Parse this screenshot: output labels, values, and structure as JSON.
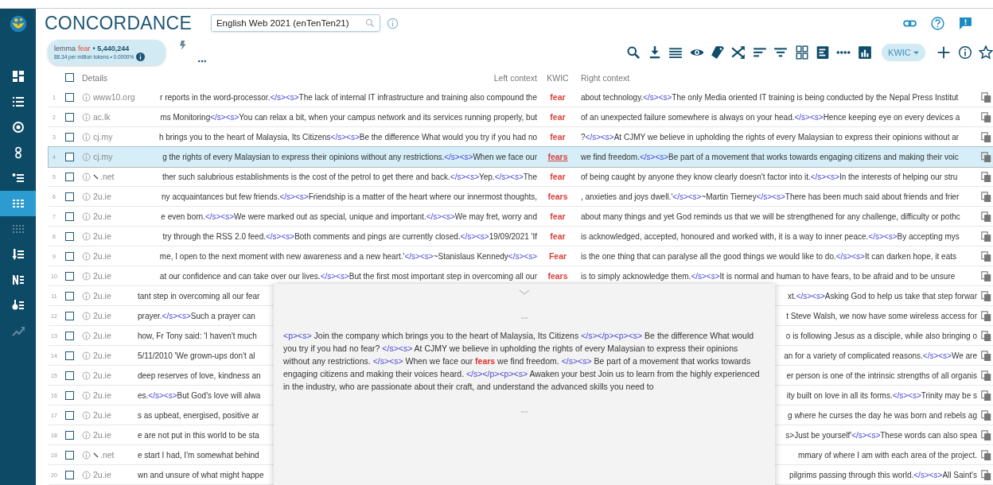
{
  "app": {
    "title": "CONCORDANCE"
  },
  "corpus_field": {
    "value": "English Web 2021 (enTenTen21)"
  },
  "sidebar": {
    "items": [
      {
        "selected": false,
        "disabled": false
      },
      {
        "selected": false,
        "disabled": false
      },
      {
        "selected": false,
        "disabled": false
      },
      {
        "selected": false,
        "disabled": false
      },
      {
        "selected": false,
        "disabled": false
      },
      {
        "selected": true,
        "disabled": false
      },
      {
        "selected": false,
        "disabled": true
      },
      {
        "selected": false,
        "disabled": false
      },
      {
        "selected": false,
        "disabled": false
      },
      {
        "selected": false,
        "disabled": false
      },
      {
        "selected": false,
        "disabled": true
      }
    ]
  },
  "query_summary": {
    "label": "lemma",
    "term": "fear",
    "hits": "• 5,440,244",
    "per_million": "88.34 per million tokens • 0.0000%"
  },
  "view_mode": {
    "label": "KWIC"
  },
  "table": {
    "select_all_checked": false,
    "columns": [
      "Details",
      "Left context",
      "KWIC",
      "Right context"
    ],
    "rows": [
      {
        "number": "1",
        "checked": false,
        "selected": false,
        "domain": "www10.org",
        "domain_icon": false,
        "left": "r reports in the word-processor.</s><s>The lack of internal IT infrastructure and training also compound the",
        "kwic": "fear",
        "right": "about technology.</s><s>The only Media oriented IT training is being conducted by the Nepal Press Institut"
      },
      {
        "number": "2",
        "checked": false,
        "selected": false,
        "domain": "ac.lk",
        "domain_icon": false,
        "left": "ms Monitoring</s><s>You can relax a bit, when your campus network and its services running properly, but",
        "kwic": "fear",
        "right": "of an unexpected failure somewhere is always on your head.</s><s>Hence keeping eye on every devices a"
      },
      {
        "number": "3",
        "checked": false,
        "selected": false,
        "domain": "cj.my",
        "domain_icon": false,
        "left": "h brings you to the heart of Malaysia, Its Citizens</s><s>Be the difference What would you try if you had no",
        "kwic": "fear",
        "right": "?</s><s>At CJMY we believe in upholding the rights of every Malaysian to express their opinions without ar"
      },
      {
        "number": "4",
        "checked": false,
        "selected": true,
        "domain": "cj.my",
        "domain_icon": false,
        "left": "g the rights of every Malaysian to express their opinions without any restrictions.</s><s>When we face our",
        "kwic": "fears",
        "right": "we find freedom.</s><s>Be part of a movement that works towards engaging citizens and making their voic"
      },
      {
        "number": "5",
        "checked": false,
        "selected": false,
        "domain": ".net",
        "domain_icon": true,
        "left": "ther such salubrious establishments is the cost of the petrol to get there and back.</s><s>Yep.</s><s>The",
        "kwic": "fear",
        "right": "of being caught by anyone they know clearly doesn't factor into it.</s><s>In the interests of helping our stru"
      },
      {
        "number": "6",
        "checked": false,
        "selected": false,
        "domain": "2u.ie",
        "domain_icon": false,
        "left": "ny acquaintances but few friends.</s><s>Friendship is a matter of the heart where our innermost thoughts,",
        "kwic": "fears",
        "right": ", anxieties and joys dwell.'</s><s>~Martin Tierney</s><s>There has been much said about friends and frier"
      },
      {
        "number": "7",
        "checked": false,
        "selected": false,
        "domain": "2u.ie",
        "domain_icon": false,
        "left": "e even born.</s><s>We were marked out as special, unique and important.</s><s>We may fret, worry and",
        "kwic": "fear",
        "right": "about many things and yet God reminds us that we will be strengthened for any challenge, difficulty or pothc"
      },
      {
        "number": "8",
        "checked": false,
        "selected": false,
        "domain": "2u.ie",
        "domain_icon": false,
        "left": "try through the RSS 2.0 feed.</s><s>Both comments and pings are currently closed.</s><s>19/09/2021 'If",
        "kwic": "fear",
        "right": "is acknowledged, accepted, honoured and worked with, it is a way to inner peace.</s><s>By accepting mys"
      },
      {
        "number": "9",
        "checked": false,
        "selected": false,
        "domain": "2u.ie",
        "domain_icon": false,
        "left": "me, I open to the next moment with new awareness and a new heart.'</s><s>~Stanislaus Kennedy</s><s>",
        "kwic": "Fear",
        "right": "is the one thing that can paralyse all the good things we would like to do.</s><s>It can darken hope, it eats"
      },
      {
        "number": "10",
        "checked": false,
        "selected": false,
        "domain": "2u.ie",
        "domain_icon": false,
        "left": "at our confidence and can take over our lives.</s><s>But the first most important step in overcoming all our",
        "kwic": "fears",
        "right": "is to simply acknowledge them.</s><s>It is normal and human to have fears, to be afraid and to be unsure"
      },
      {
        "number": "11",
        "checked": false,
        "selected": false,
        "domain": "2u.ie",
        "domain_icon": false,
        "left": "tant step in overcoming all our fear",
        "right": "xt.</s><s>Asking God to help us take that step forwar"
      },
      {
        "number": "12",
        "checked": false,
        "selected": false,
        "domain": "2u.ie",
        "domain_icon": false,
        "left": "prayer.</s><s>Such a prayer can",
        "right": "t Steve Walsh, we now have some wireless access for"
      },
      {
        "number": "13",
        "checked": false,
        "selected": false,
        "domain": "2u.ie",
        "domain_icon": false,
        "left": "how, Fr Tony said: 'I haven't much",
        "right": "o is following Jesus as a disciple, while also bringing o"
      },
      {
        "number": "14",
        "checked": false,
        "selected": false,
        "domain": "2u.ie",
        "domain_icon": false,
        "left": "5/11/2010 'We grown-ups don't al",
        "right": "an for a variety of complicated reasons.</s><s>We are"
      },
      {
        "number": "15",
        "checked": false,
        "selected": false,
        "domain": "2u.ie",
        "domain_icon": false,
        "left": "deep reserves of love, kindness an",
        "right": "er person is one of the intrinsic strengths of all organis"
      },
      {
        "number": "16",
        "checked": false,
        "selected": false,
        "domain": "2u.ie",
        "domain_icon": false,
        "left": "es.</s><s>But God's love will alwa",
        "right": "ity built on love in all its forms.</s><s>Trinity may be s"
      },
      {
        "number": "17",
        "checked": false,
        "selected": false,
        "domain": "2u.ie",
        "domain_icon": false,
        "left": "s as upbeat, energised, positive ar",
        "right": "g where he curses the day he was born and rebels ag"
      },
      {
        "number": "18",
        "checked": false,
        "selected": false,
        "domain": "2u.ie",
        "domain_icon": false,
        "left": "e are not put in this world to be sta",
        "right": "s>Just be yourself'</s><s>These words can also spea"
      },
      {
        "number": "19",
        "checked": false,
        "selected": false,
        "domain": ".net",
        "domain_icon": true,
        "left": "e start I had, I'm somewhat behind",
        "right": "mmary of where I am with each area of the project."
      },
      {
        "number": "20",
        "checked": false,
        "selected": false,
        "domain": "2u.ie",
        "domain_icon": false,
        "left": "wn and unsure of what might happe",
        "right": "pilgrims passing through this world.</s><s>All Saint's"
      }
    ]
  },
  "detail_popup": {
    "text": "<p><s> Join the company which brings you to the heart of Malaysia, Its Citizens </s></p><p><s> Be the difference What would you try if you had no fear? </s><s> At CJMY we believe in upholding the rights of every Malaysian to express their opinions without any restrictions. </s><s> When we face our **fears** we find freedom. </s><s> Be part of a movement that works towards engaging citizens and making their voices heard. </s></p><p><s> Awaken your best Join us to learn from the highly experienced in the industry, who are passionate about their craft, and understand the advanced skills you need to"
  }
}
